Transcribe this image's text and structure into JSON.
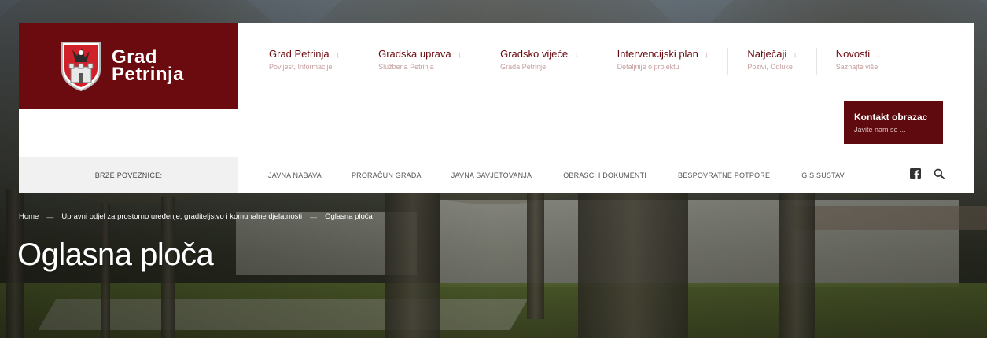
{
  "brand": {
    "line1": "Grad",
    "line2": "Petrinja",
    "color": "#6b0a0f"
  },
  "main_nav": [
    {
      "title": "Grad Petrinja",
      "subtitle": "Povijest, Informacije"
    },
    {
      "title": "Gradska uprava",
      "subtitle": "Službena Petrinja"
    },
    {
      "title": "Gradsko vijeće",
      "subtitle": "Grada Petrinje"
    },
    {
      "title": "Intervencijski plan",
      "subtitle": "Detaljnije o projektu"
    },
    {
      "title": "Natječaji",
      "subtitle": "Pozivi, Odluke"
    },
    {
      "title": "Novosti",
      "subtitle": "Saznajte više"
    }
  ],
  "nav_arrow": "↓",
  "contact": {
    "title": "Kontakt obrazac",
    "subtitle": "Javite nam se ..."
  },
  "quick_bar": {
    "label": "BRZE POVEZNICE:",
    "links": [
      "JAVNA NABAVA",
      "PRORAČUN GRADA",
      "JAVNA SAVJETOVANJA",
      "OBRASCI I DOKUMENTI",
      "BESPOVRATNE POTPORE",
      "GIS SUSTAV"
    ],
    "icons": [
      "facebook-icon",
      "search-icon"
    ]
  },
  "breadcrumb": {
    "items": [
      "Home",
      "Upravni odjel za prostorno uređenje, graditeljstvo i komunalne djelatnosti",
      "Oglasna ploča"
    ],
    "separator": "—"
  },
  "page_title": "Oglasna ploča"
}
